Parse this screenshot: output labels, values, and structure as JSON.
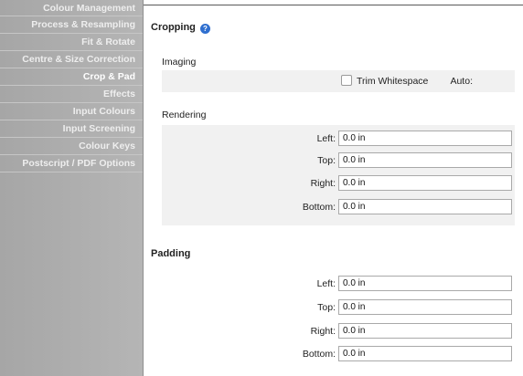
{
  "sidebar": {
    "items": [
      {
        "label": "Colour Management"
      },
      {
        "label": "Process & Resampling"
      },
      {
        "label": "Fit & Rotate"
      },
      {
        "label": "Centre & Size Correction"
      },
      {
        "label": "Crop & Pad",
        "active": true
      },
      {
        "label": "Effects"
      },
      {
        "label": "Input Colours"
      },
      {
        "label": "Input Screening"
      },
      {
        "label": "Colour Keys"
      },
      {
        "label": "Postscript / PDF Options"
      }
    ]
  },
  "cropping": {
    "title": "Cropping",
    "help_icon": "?",
    "imaging": {
      "title": "Imaging",
      "auto_label": "Auto:",
      "trim_whitespace_label": "Trim Whitespace",
      "trim_whitespace_checked": false
    },
    "rendering": {
      "title": "Rendering",
      "left_label": "Left:",
      "left_value": "0.0 in",
      "top_label": "Top:",
      "top_value": "0.0 in",
      "right_label": "Right:",
      "right_value": "0.0 in",
      "bottom_label": "Bottom:",
      "bottom_value": "0.0 in"
    }
  },
  "padding": {
    "title": "Padding",
    "left_label": "Left:",
    "left_value": "0.0 in",
    "top_label": "Top:",
    "top_value": "0.0 in",
    "right_label": "Right:",
    "right_value": "0.0 in",
    "bottom_label": "Bottom:",
    "bottom_value": "0.0 in"
  }
}
